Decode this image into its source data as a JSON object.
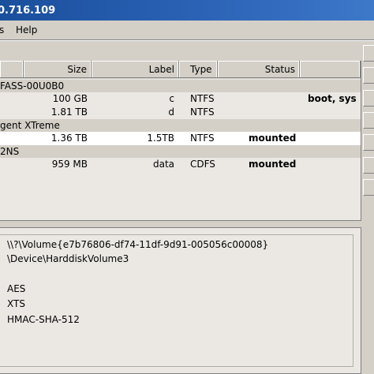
{
  "window": {
    "title": "0.716.109"
  },
  "menu": {
    "item_partial": "s",
    "help": "Help"
  },
  "list": {
    "columns": {
      "size": "Size",
      "label": "Label",
      "type": "Type",
      "status": "Status"
    },
    "groups": [
      {
        "name": "FASS-00U0B0",
        "volumes": [
          {
            "size": "100 GB",
            "label": "c",
            "type": "NTFS",
            "status": "",
            "extra": "boot, sys"
          },
          {
            "size": "1.81 TB",
            "label": "d",
            "type": "NTFS",
            "status": "",
            "extra": ""
          }
        ]
      },
      {
        "name": "gent XTreme",
        "volumes": [
          {
            "size": "1.36 TB",
            "label": "1.5TB",
            "type": "NTFS",
            "status": "mounted",
            "extra": ""
          }
        ]
      },
      {
        "name": "2NS",
        "volumes": [
          {
            "size": "959 MB",
            "label": "data",
            "type": "CDFS",
            "status": "mounted",
            "extra": ""
          }
        ]
      }
    ]
  },
  "details": {
    "volume_guid": "\\\\?\\Volume{e7b76806-df74-11df-9d91-005056c00008}",
    "device": "\\Device\\HarddiskVolume3",
    "algorithm": "AES",
    "mode": "XTS",
    "hash": "HMAC-SHA-512"
  }
}
